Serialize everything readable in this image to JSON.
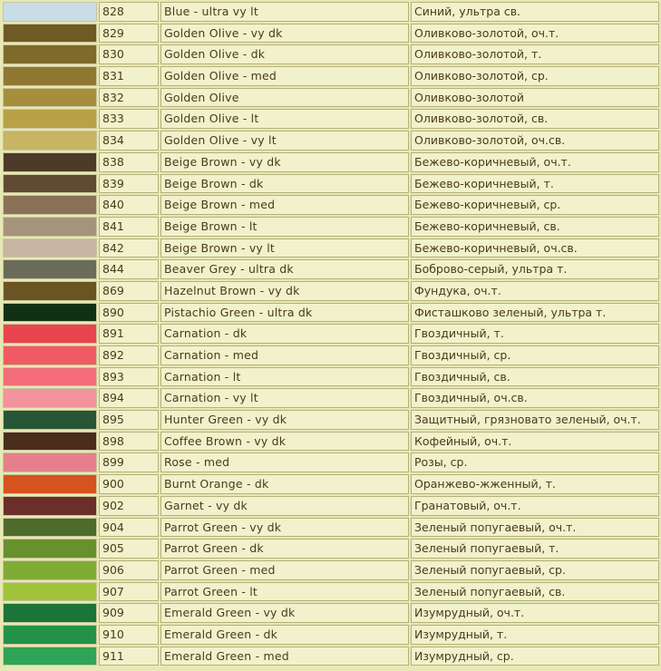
{
  "rows": [
    {
      "color": "#c8dde6",
      "number": "828",
      "name_en": "Blue - ultra vy lt",
      "name_ru": "Синий, ультра св."
    },
    {
      "color": "#6e5a25",
      "number": "829",
      "name_en": "Golden Olive - vy dk",
      "name_ru": "Оливково-золотой, оч.т."
    },
    {
      "color": "#7f6a2b",
      "number": "830",
      "name_en": "Golden Olive - dk",
      "name_ru": "Оливково-золотой, т."
    },
    {
      "color": "#8f7833",
      "number": "831",
      "name_en": "Golden Olive - med",
      "name_ru": "Оливково-золотой, ср."
    },
    {
      "color": "#a68e3d",
      "number": "832",
      "name_en": "Golden Olive",
      "name_ru": "Оливково-золотой"
    },
    {
      "color": "#b8a147",
      "number": "833",
      "name_en": "Golden Olive - lt",
      "name_ru": "Оливково-золотой, св."
    },
    {
      "color": "#c7b464",
      "number": "834",
      "name_en": "Golden Olive - vy lt",
      "name_ru": "Оливково-золотой, оч.св."
    },
    {
      "color": "#4d3a28",
      "number": "838",
      "name_en": "Beige Brown - vy dk",
      "name_ru": "Бежево-коричневый, оч.т."
    },
    {
      "color": "#614a33",
      "number": "839",
      "name_en": "Beige Brown - dk",
      "name_ru": "Бежево-коричневый, т."
    },
    {
      "color": "#8a7158",
      "number": "840",
      "name_en": "Beige Brown - med",
      "name_ru": "Бежево-коричневый, ср."
    },
    {
      "color": "#a6937c",
      "number": "841",
      "name_en": "Beige Brown - lt",
      "name_ru": "Бежево-коричневый, св."
    },
    {
      "color": "#c6b6a3",
      "number": "842",
      "name_en": "Beige Brown - vy lt",
      "name_ru": "Бежево-коричневый, оч.св."
    },
    {
      "color": "#6a6b5a",
      "number": "844",
      "name_en": "Beaver Grey - ultra dk",
      "name_ru": "Боброво-серый, ультра т."
    },
    {
      "color": "#6a5424",
      "number": "869",
      "name_en": "Hazelnut Brown - vy dk",
      "name_ru": "Фундука, оч.т."
    },
    {
      "color": "#123014",
      "number": "890",
      "name_en": "Pistachio Green - ultra dk",
      "name_ru": "Фисташково зеленый, ультра т."
    },
    {
      "color": "#e8454f",
      "number": "891",
      "name_en": "Carnation - dk",
      "name_ru": "Гвоздичный, т."
    },
    {
      "color": "#f05a64",
      "number": "892",
      "name_en": "Carnation - med",
      "name_ru": "Гвоздичный, ср."
    },
    {
      "color": "#f46c7a",
      "number": "893",
      "name_en": "Carnation - lt",
      "name_ru": "Гвоздичный, св."
    },
    {
      "color": "#f2939e",
      "number": "894",
      "name_en": "Carnation - vy lt",
      "name_ru": "Гвоздичный, оч.св."
    },
    {
      "color": "#285535",
      "number": "895",
      "name_en": "Hunter Green - vy dk",
      "name_ru": "Защитный, грязновато зеленый, оч.т."
    },
    {
      "color": "#4a2d1d",
      "number": "898",
      "name_en": "Coffee Brown - vy dk",
      "name_ru": "Кофейный, оч.т."
    },
    {
      "color": "#e67f8c",
      "number": "899",
      "name_en": "Rose - med",
      "name_ru": "Розы, ср."
    },
    {
      "color": "#d6521f",
      "number": "900",
      "name_en": "Burnt Orange - dk",
      "name_ru": "Оранжево-жженный, т."
    },
    {
      "color": "#6b2e2b",
      "number": "902",
      "name_en": "Garnet - vy dk",
      "name_ru": "Гранатовый, оч.т."
    },
    {
      "color": "#4d6b2b",
      "number": "904",
      "name_en": "Parrot Green - vy dk",
      "name_ru": "Зеленый попугаевый, оч.т."
    },
    {
      "color": "#67902f",
      "number": "905",
      "name_en": "Parrot Green - dk",
      "name_ru": "Зеленый попугаевый, т."
    },
    {
      "color": "#80ac35",
      "number": "906",
      "name_en": "Parrot Green - med",
      "name_ru": "Зеленый попугаевый, ср."
    },
    {
      "color": "#a1c33b",
      "number": "907",
      "name_en": "Parrot Green - lt",
      "name_ru": "Зеленый попугаевый, св."
    },
    {
      "color": "#1b7438",
      "number": "909",
      "name_en": "Emerald Green - vy dk",
      "name_ru": "Изумрудный, оч.т."
    },
    {
      "color": "#239248",
      "number": "910",
      "name_en": "Emerald Green - dk",
      "name_ru": "Изумрудный, т."
    },
    {
      "color": "#2fa457",
      "number": "911",
      "name_en": "Emerald Green - med",
      "name_ru": "Изумрудный, ср."
    }
  ]
}
